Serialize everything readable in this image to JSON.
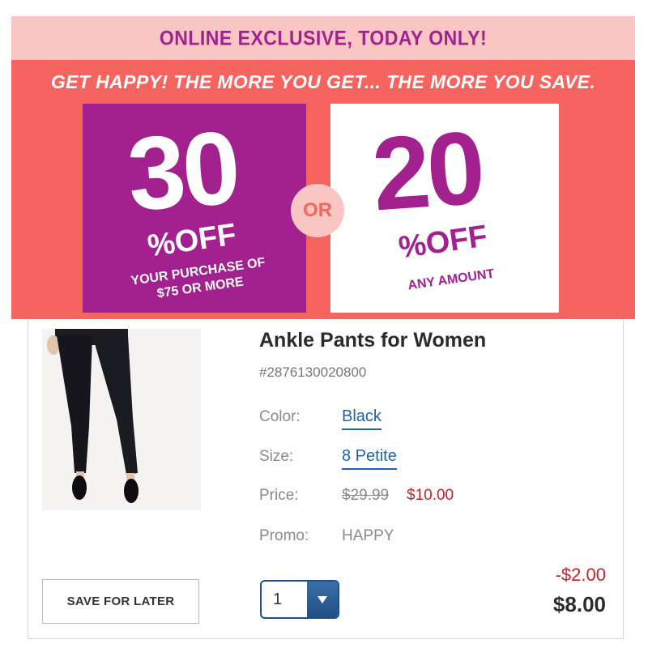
{
  "banner": {
    "top_text": "ONLINE EXCLUSIVE, TODAY ONLY!",
    "headline": "GET HAPPY! THE MORE YOU GET... THE MORE YOU SAVE.",
    "offer_left": {
      "amount": "30",
      "percent_off": "%OFF",
      "line1": "YOUR PURCHASE OF",
      "line2": "$75 OR MORE"
    },
    "or_text": "OR",
    "offer_right": {
      "amount": "20",
      "percent_off": "%OFF",
      "line1": "ANY AMOUNT"
    },
    "colors": {
      "coral": "#f6645f",
      "pink": "#f9c6c3",
      "purple": "#a3208f"
    }
  },
  "product": {
    "image_icon": "ankle-pants-photo",
    "title": "Ankle Pants for Women",
    "sku": "#2876130020800",
    "color_label": "Color:",
    "color_value": "Black",
    "size_label": "Size:",
    "size_value": "8 Petite",
    "price_label": "Price:",
    "price_original": "$29.99",
    "price_sale": "$10.00",
    "promo_label": "Promo:",
    "promo_value": "HAPPY"
  },
  "actions": {
    "save_for_later": "SAVE FOR LATER",
    "quantity": "1",
    "quantity_icon": "chevron-down-icon"
  },
  "totals": {
    "discount": "-$2.00",
    "total": "$8.00"
  }
}
